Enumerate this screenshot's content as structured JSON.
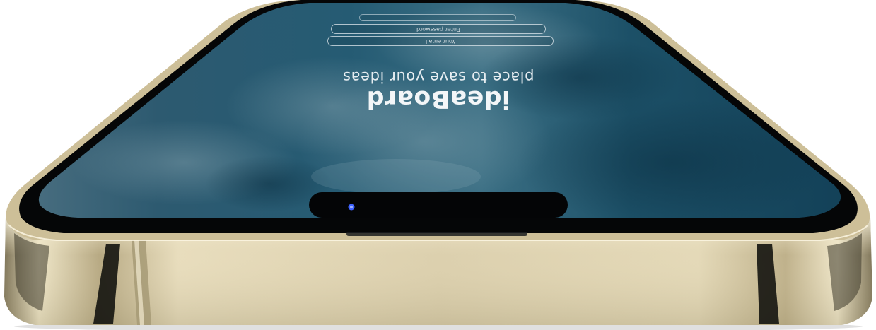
{
  "app": {
    "title": "ideaBoard",
    "tagline": "place to save your ideas"
  },
  "login": {
    "email_placeholder": "Your email",
    "password_placeholder": "Enter password",
    "extra_field_placeholder": ""
  },
  "colors": {
    "frame_gold": "#d8caa3",
    "screen_blue": "#1f5269",
    "bezel_black": "#060708",
    "indicator_blue": "#3f63ff"
  }
}
